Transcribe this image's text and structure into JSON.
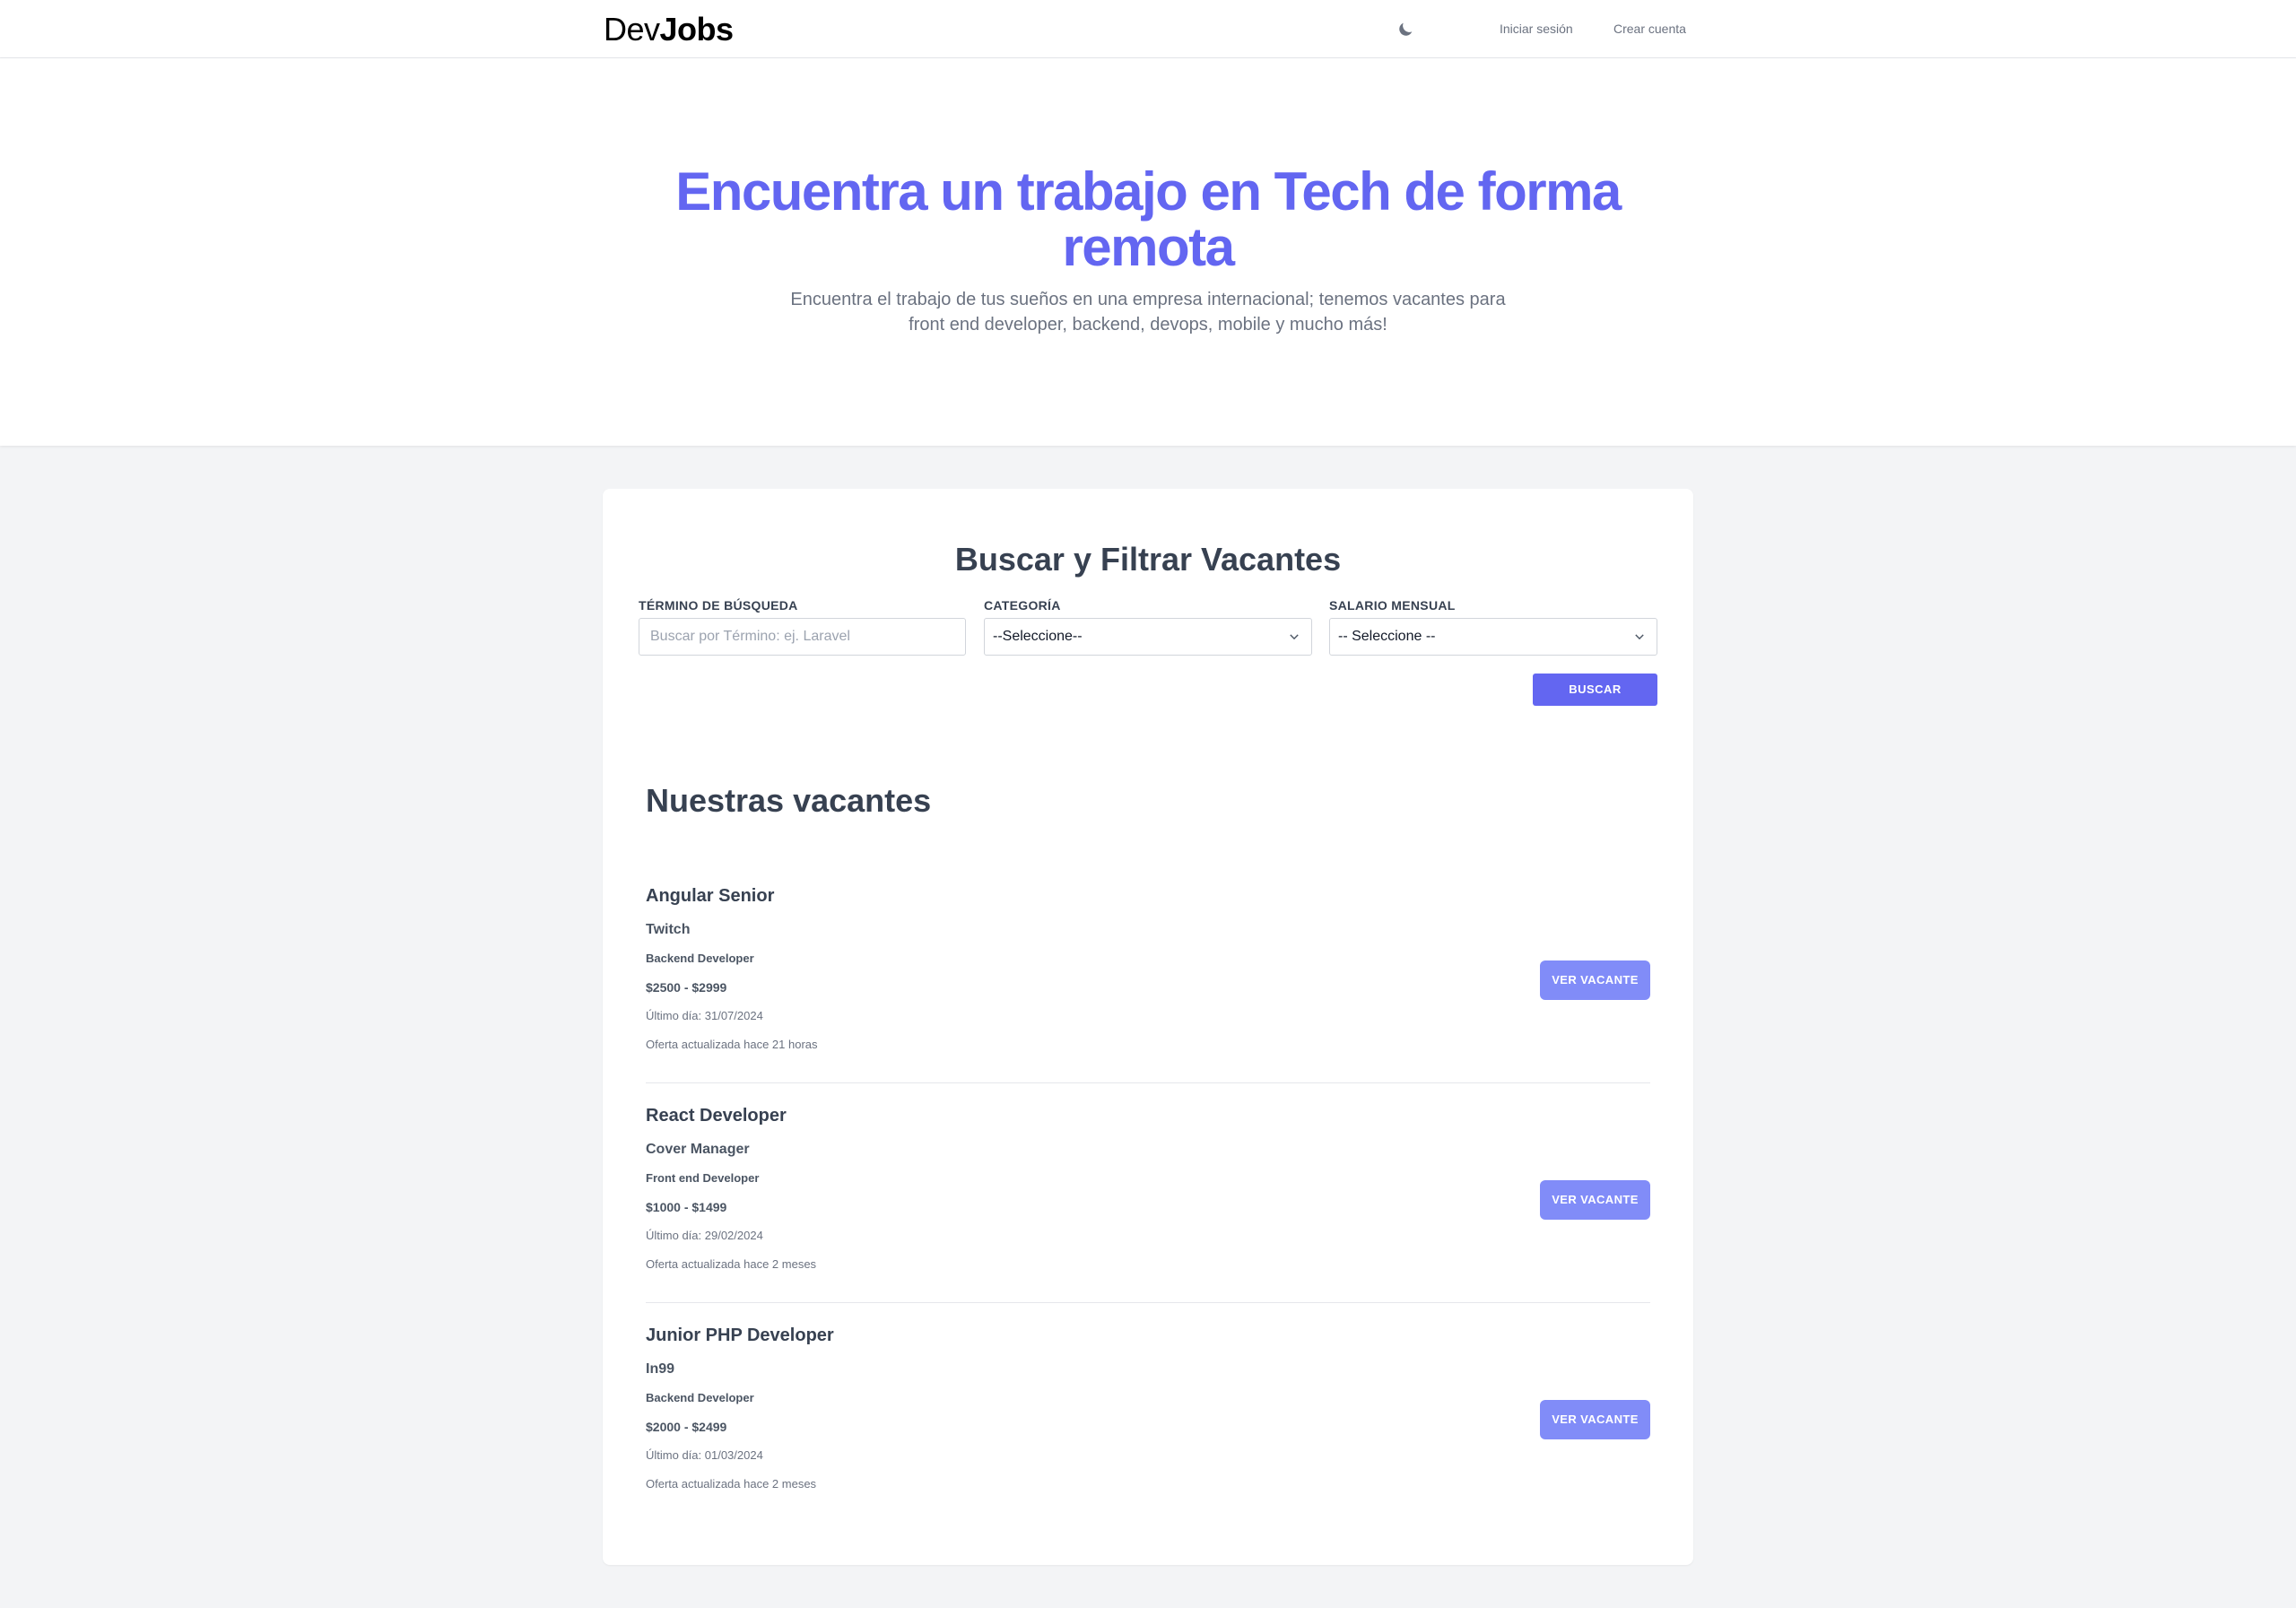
{
  "nav": {
    "logo_light": "Dev",
    "logo_bold": "Jobs",
    "theme_icon": "moon-icon",
    "login": "Iniciar sesión",
    "register": "Crear cuenta"
  },
  "hero": {
    "title": "Encuentra un trabajo en Tech de forma remota",
    "subtitle": "Encuentra el trabajo de tus sueños en una empresa internacional; tenemos vacantes para front end developer, backend, devops, mobile y mucho más!",
    "title_color": "#6366f1"
  },
  "search": {
    "title": "Buscar y Filtrar Vacantes",
    "term_label": "Término de búsqueda",
    "term_placeholder": "Buscar por Término: ej. Laravel",
    "term_value": "",
    "category_label": "Categoría",
    "category_value": "--Seleccione--",
    "salary_label": "Salario Mensual",
    "salary_value": "-- Seleccione --",
    "submit": "Buscar",
    "accent_color": "#6366f1"
  },
  "vacancies": {
    "title": "Nuestras vacantes",
    "button_label": "Ver vacante",
    "items": [
      {
        "title": "Angular Senior",
        "company": "Twitch",
        "category": "Backend Developer",
        "salary": "$2500 - $2999",
        "last_day": "Último día: 31/07/2024",
        "updated": "Oferta actualizada hace 21 horas"
      },
      {
        "title": "React Developer",
        "company": "Cover Manager",
        "category": "Front end Developer",
        "salary": "$1000 - $1499",
        "last_day": "Último día: 29/02/2024",
        "updated": "Oferta actualizada hace 2 meses"
      },
      {
        "title": "Junior PHP Developer",
        "company": "In99",
        "category": "Backend Developer",
        "salary": "$2000 - $2499",
        "last_day": "Último día: 01/03/2024",
        "updated": "Oferta actualizada hace 2 meses"
      }
    ]
  }
}
